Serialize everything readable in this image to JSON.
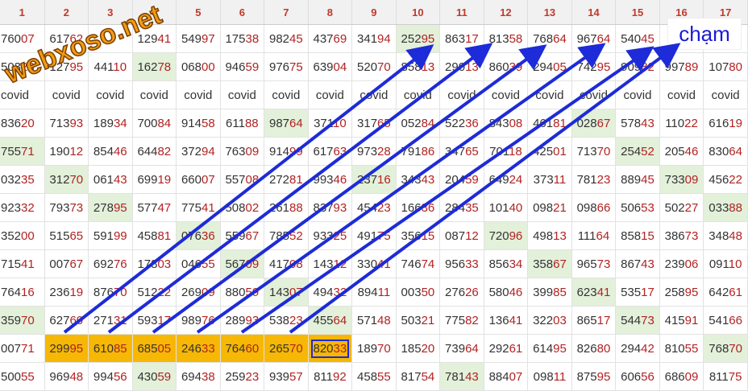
{
  "columns": [
    "1",
    "2",
    "3",
    "4",
    "5",
    "6",
    "7",
    "8",
    "9",
    "10",
    "11",
    "12",
    "13",
    "14",
    "15",
    "16",
    "17"
  ],
  "rows": [
    [
      "76007",
      "61762",
      "",
      "12941",
      "54997",
      "17538",
      "98245",
      "43769",
      "34194",
      "25295",
      "86317",
      "81358",
      "76864",
      "96764",
      "54045",
      "",
      ""
    ],
    [
      "50323",
      "12795",
      "44110",
      "16278",
      "06800",
      "94659",
      "97675",
      "63904",
      "52070",
      "85813",
      "29013",
      "86039",
      "29405",
      "74295",
      "90982",
      "99789",
      "10780"
    ],
    [
      "covid",
      "covid",
      "covid",
      "covid",
      "covid",
      "covid",
      "covid",
      "covid",
      "covid",
      "covid",
      "covid",
      "covid",
      "covid",
      "covid",
      "covid",
      "covid",
      "covid"
    ],
    [
      "83620",
      "71393",
      "18934",
      "70084",
      "91458",
      "61188",
      "98764",
      "37110",
      "31765",
      "05284",
      "52236",
      "84308",
      "46181",
      "02867",
      "57843",
      "11022",
      "61619"
    ],
    [
      "75571",
      "19012",
      "85446",
      "64482",
      "37294",
      "76309",
      "91499",
      "61763",
      "97328",
      "79186",
      "34765",
      "70118",
      "42501",
      "71370",
      "25452",
      "20546",
      "83064"
    ],
    [
      "03235",
      "31270",
      "06143",
      "69919",
      "66007",
      "55708",
      "27281",
      "99346",
      "23716",
      "34343",
      "20459",
      "64924",
      "37311",
      "78123",
      "88945",
      "73309",
      "45622"
    ],
    [
      "92332",
      "79373",
      "27895",
      "57747",
      "77541",
      "50802",
      "26188",
      "83793",
      "45423",
      "16636",
      "28435",
      "10140",
      "09821",
      "09866",
      "50653",
      "50227",
      "03388"
    ],
    [
      "35200",
      "51565",
      "59199",
      "45881",
      "07636",
      "55967",
      "78552",
      "93325",
      "49175",
      "35615",
      "08712",
      "72096",
      "49813",
      "11164",
      "85815",
      "38673",
      "34848"
    ],
    [
      "71541",
      "00767",
      "69276",
      "17803",
      "04655",
      "56709",
      "41708",
      "14312",
      "33041",
      "74674",
      "95633",
      "85634",
      "35867",
      "96573",
      "86743",
      "23906",
      "09110"
    ],
    [
      "76416",
      "23619",
      "87670",
      "51222",
      "26909",
      "88059",
      "14307",
      "49432",
      "89411",
      "00350",
      "27626",
      "58046",
      "39985",
      "62341",
      "53517",
      "25895",
      "64261"
    ],
    [
      "35970",
      "62760",
      "27131",
      "59317",
      "98976",
      "28993",
      "53823",
      "45564",
      "57148",
      "50321",
      "77582",
      "13641",
      "32203",
      "86517",
      "54473",
      "41591",
      "54166"
    ],
    [
      "00771",
      "29995",
      "61085",
      "68505",
      "24633",
      "76460",
      "26570",
      "82033",
      "18970",
      "18520",
      "73964",
      "29261",
      "61495",
      "82680",
      "29442",
      "81055",
      "76870"
    ],
    [
      "50055",
      "96948",
      "99456",
      "43059",
      "69438",
      "25923",
      "93957",
      "81192",
      "45855",
      "81754",
      "78143",
      "88407",
      "09811",
      "87595",
      "60656",
      "68609",
      "81175"
    ]
  ],
  "logo_text": "webxoso.net",
  "label_cham": "chạm",
  "colors": {
    "header_number": "#c0392b",
    "highlight_green": "#e3f0da",
    "highlight_orange": "#f6b705",
    "arrow_blue": "#1d2bd8",
    "tail_digits": "#b22222"
  }
}
